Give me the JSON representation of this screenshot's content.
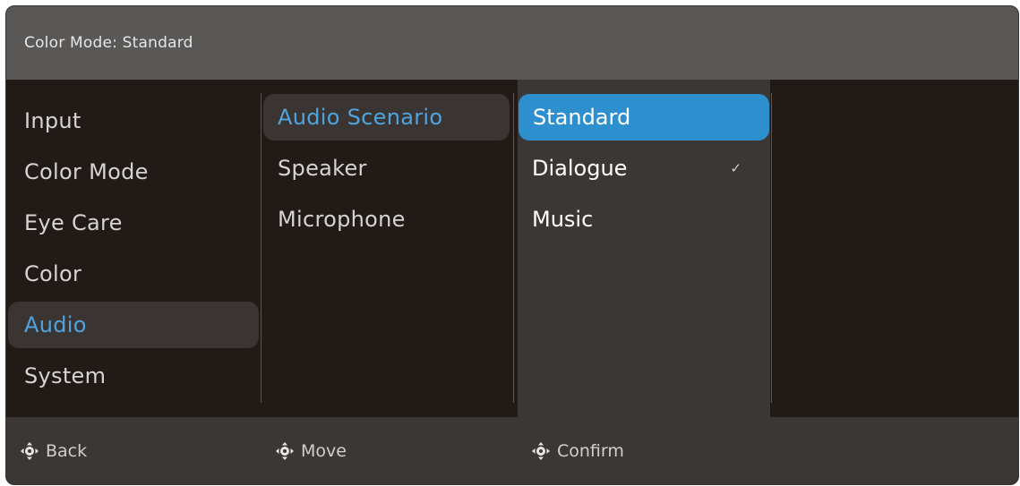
{
  "header": {
    "title": "Color Mode: Standard"
  },
  "menu": {
    "items": [
      {
        "label": "Input"
      },
      {
        "label": "Color Mode"
      },
      {
        "label": "Eye Care"
      },
      {
        "label": "Color"
      },
      {
        "label": "Audio"
      },
      {
        "label": "System"
      }
    ],
    "selected": "Audio"
  },
  "submenu": {
    "items": [
      {
        "label": "Audio Scenario"
      },
      {
        "label": "Speaker"
      },
      {
        "label": "Microphone"
      }
    ],
    "selected": "Audio Scenario"
  },
  "options": {
    "items": [
      {
        "label": "Standard"
      },
      {
        "label": "Dialogue",
        "check": "✓"
      },
      {
        "label": "Music"
      }
    ],
    "highlighted": "Standard",
    "checked": "Dialogue"
  },
  "footer": {
    "back_label": "Back",
    "move_label": "Move",
    "confirm_label": "Confirm"
  },
  "colors": {
    "accent": "#4fa4df",
    "highlight": "#2e8fce",
    "panel": "#221a17",
    "header": "#5a5856"
  }
}
